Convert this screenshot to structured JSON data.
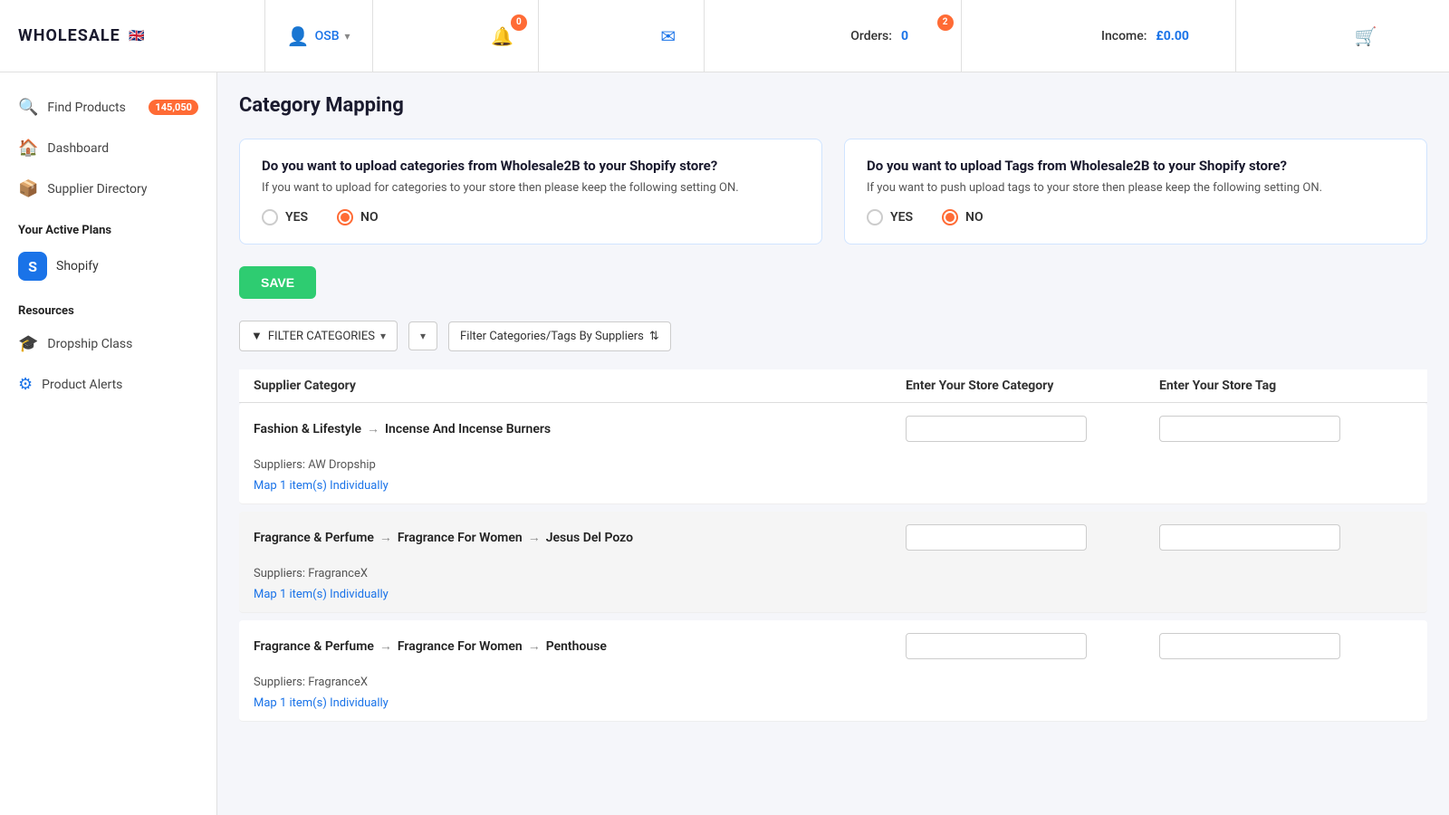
{
  "brand": {
    "name": "WHOLESALE",
    "flag_emoji": "🇬🇧"
  },
  "topnav": {
    "user_label": "OSB",
    "bell_badge": "0",
    "orders_label": "Orders:",
    "orders_value": "0",
    "orders_badge": "2",
    "income_label": "Income:",
    "income_value": "£0.00",
    "cart_icon": "cart"
  },
  "sidebar": {
    "find_products_label": "Find Products",
    "find_products_badge": "145,050",
    "dashboard_label": "Dashboard",
    "supplier_directory_label": "Supplier Directory",
    "active_plans_title": "Your Active Plans",
    "shopify_label": "Shopify",
    "resources_title": "Resources",
    "dropship_class_label": "Dropship Class",
    "product_alerts_label": "Product Alerts"
  },
  "page": {
    "title": "Category Mapping"
  },
  "categories_card": {
    "question": "Do you want to upload categories from Wholesale2B to your Shopify store?",
    "hint": "If you want to upload for categories to your store then please keep the following setting ON.",
    "yes_label": "YES",
    "no_label": "NO",
    "no_selected": true
  },
  "tags_card": {
    "question": "Do you want to upload Tags from Wholesale2B to your Shopify store?",
    "hint": "If you want to push upload tags to your store then please keep the following setting ON.",
    "yes_label": "YES",
    "no_label": "NO",
    "no_selected": true
  },
  "save_button_label": "SAVE",
  "filter": {
    "categories_label": "FILTER CATEGORIES",
    "supplier_label": "Filter Categories/Tags By Suppliers"
  },
  "table": {
    "col1": "Supplier Category",
    "col2": "Enter Your Store Category",
    "col3": "Enter Your Store Tag",
    "rows": [
      {
        "id": 1,
        "category_path": [
          "Fashion & Lifestyle",
          "Incense And Incense Burners"
        ],
        "suppliers": "AW Dropship",
        "map_link": "Map 1 item(s) Individually",
        "bg": "white"
      },
      {
        "id": 2,
        "category_path": [
          "Fragrance & Perfume",
          "Fragrance For Women",
          "Jesus Del Pozo"
        ],
        "suppliers": "FragranceX",
        "map_link": "Map 1 item(s) Individually",
        "bg": "gray"
      },
      {
        "id": 3,
        "category_path": [
          "Fragrance & Perfume",
          "Fragrance For Women",
          "Penthouse"
        ],
        "suppliers": "FragranceX",
        "map_link": "Map 1 item(s) Individually",
        "bg": "white"
      }
    ]
  }
}
